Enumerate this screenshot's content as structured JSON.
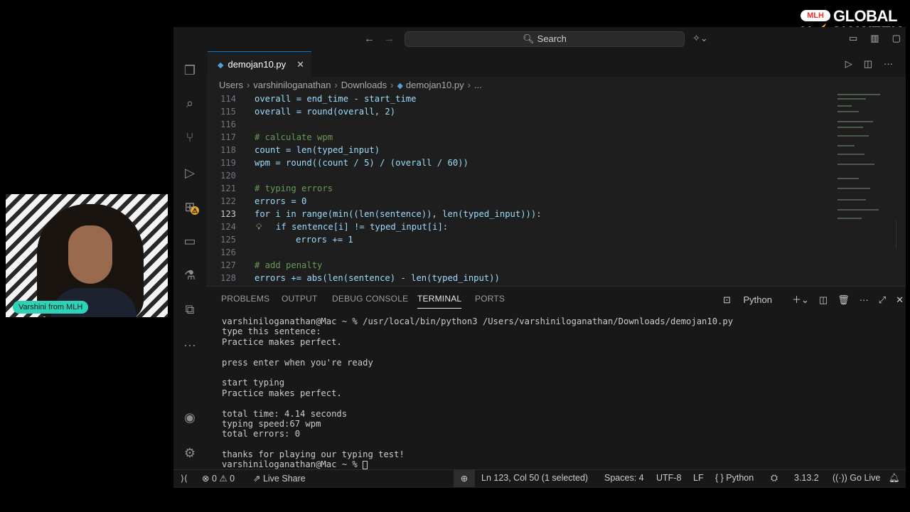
{
  "brand": {
    "mlh": "MLH",
    "line1": "GLOBAL",
    "line2_a": "H",
    "line2_bolt": "⚡",
    "line2_b": "CK WEEK"
  },
  "webcam": {
    "label": "Varshini from MLH"
  },
  "titlebar": {
    "back": "←",
    "forward": "→",
    "search": "Search",
    "search_icon": "🔍︎",
    "copilot": "✧⌄",
    "controls": [
      "▭",
      "▥",
      "▢",
      "▤"
    ]
  },
  "activitybar": {
    "icons": [
      "explorer-icon",
      "search-icon",
      "source-control-icon",
      "run-debug-icon",
      "extensions-icon",
      "remote-icon",
      "testing-icon",
      "docker-icon",
      "more-icon",
      "account-icon",
      "settings-icon"
    ],
    "extensions_badge": "⚠"
  },
  "tab": {
    "filename": "demojan10.py",
    "close": "✕"
  },
  "tab_actions": {
    "run": "▷",
    "split": "◫",
    "more": "···"
  },
  "breadcrumb": [
    "Users",
    "varshiniloganathan",
    "Downloads",
    "demojan10.py",
    "..."
  ],
  "editor": {
    "lines": [
      {
        "n": "114",
        "code": "overall = end_time - start_time"
      },
      {
        "n": "115",
        "code": "overall = round(overall, 2)"
      },
      {
        "n": "116",
        "code": ""
      },
      {
        "n": "117",
        "code": "# calculate wpm"
      },
      {
        "n": "118",
        "code": "count = len(typed_input)"
      },
      {
        "n": "119",
        "code": "wpm = round((count / 5) / (overall / 60))"
      },
      {
        "n": "120",
        "code": ""
      },
      {
        "n": "121",
        "code": "# typing errors"
      },
      {
        "n": "122",
        "code": "errors = 0"
      },
      {
        "n": "123",
        "code": "for i in range(min((len(sentence)), len(typed_input))):"
      },
      {
        "n": "124",
        "code": "if sentence[i] != typed_input[i]:"
      },
      {
        "n": "125",
        "code": "errors += 1"
      },
      {
        "n": "126",
        "code": ""
      },
      {
        "n": "127",
        "code": "# add penalty"
      },
      {
        "n": "128",
        "code": "errors += abs(len(sentence) - len(typed_input))"
      }
    ]
  },
  "panel": {
    "tabs": [
      "PROBLEMS",
      "OUTPUT",
      "DEBUG CONSOLE",
      "TERMINAL",
      "PORTS"
    ],
    "active_tab": "TERMINAL",
    "shell": "Python",
    "terminal_lines": [
      "varshiniloganathan@Mac ~ % /usr/local/bin/python3 /Users/varshiniloganathan/Downloads/demojan10.py",
      "type this sentence:",
      "Practice makes perfect.",
      "",
      "press enter when you're ready",
      "",
      "start typing",
      "Practice makes perfect.",
      "",
      "total time: 4.14 seconds",
      "typing speed:67 wpm",
      "total errors: 0",
      "",
      "thanks for playing our typing test!",
      "varshiniloganathan@Mac ~ % "
    ]
  },
  "statusbar": {
    "remote": "⟩⟨",
    "errors": "0",
    "warnings": "0",
    "live_share": "Live Share",
    "position": "Ln 123, Col 50 (1 selected)",
    "spaces": "Spaces: 4",
    "encoding": "UTF-8",
    "eol": "LF",
    "language": "Python",
    "version": "3.13.2",
    "go_live": "Go Live"
  }
}
